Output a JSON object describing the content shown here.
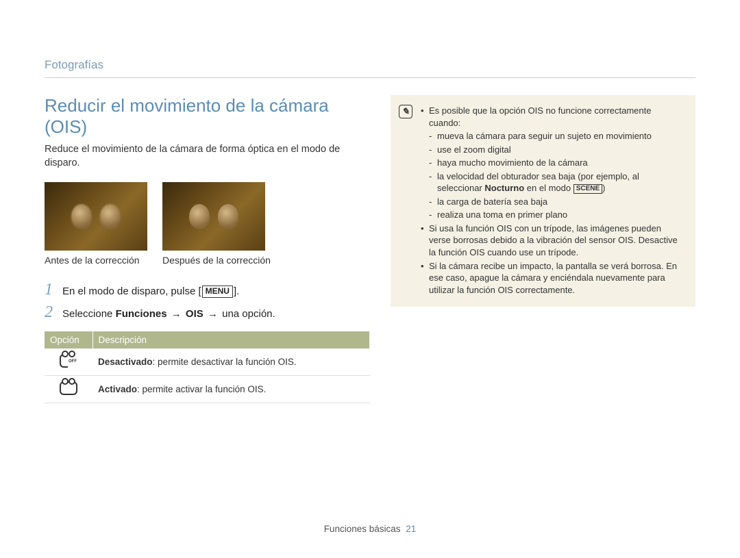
{
  "breadcrumb": "Fotografías",
  "heading": "Reducir el movimiento de la cámara (OIS)",
  "intro": "Reduce el movimiento de la cámara de forma óptica en el modo de disparo.",
  "samples": {
    "before": "Antes de la corrección",
    "after": "Después de la corrección"
  },
  "steps": {
    "s1_pre": "En el modo de disparo, pulse [",
    "s1_menu": "MENU",
    "s1_post": "].",
    "s2_pre": "Seleccione ",
    "s2_funciones": "Funciones",
    "s2_arrow": " → ",
    "s2_ois": "OIS",
    "s2_post": " una opción."
  },
  "table": {
    "th1": "Opción",
    "th2": "Descripción",
    "row1_label": "Desactivado",
    "row1_desc": ": permite desactivar la función OIS.",
    "row2_label": "Activado",
    "row2_desc": ": permite activar la función OIS."
  },
  "notes": {
    "n1": "Es posible que la opción OIS no funcione correctamente cuando:",
    "n1a": "mueva la cámara para seguir un sujeto en movimiento",
    "n1b": "use el zoom digital",
    "n1c": "haya mucho movimiento de la cámara",
    "n1d_pre": "la velocidad del obturador sea baja (por ejemplo, al seleccionar ",
    "n1d_bold": "Nocturno",
    "n1d_mid": " en el modo ",
    "n1d_scene": "SCENE",
    "n1d_post": ")",
    "n1e": "la carga de batería sea baja",
    "n1f": "realiza una toma en primer plano",
    "n2": "Si usa la función OIS con un trípode, las imágenes pueden verse borrosas debido a la vibración del sensor OIS. Desactive la función OIS cuando use un trípode.",
    "n3": "Si la cámara recibe un impacto, la pantalla se verá borrosa. En ese caso, apague la cámara y enciéndala nuevamente para utilizar la función OIS correctamente."
  },
  "footer": {
    "section": "Funciones básicas",
    "page": "21"
  }
}
